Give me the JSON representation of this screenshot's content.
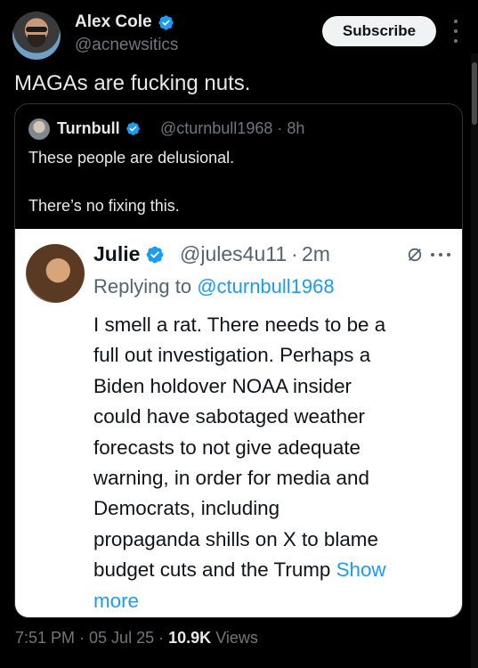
{
  "tweet": {
    "author": {
      "name": "Alex Cole",
      "handle": "@acnewsitics"
    },
    "subscribe_label": "Subscribe",
    "text": "MAGAs are fucking nuts.",
    "timestamp": "7:51 PM · 05 Jul 25",
    "separator": "·",
    "views_count": "10.9K",
    "views_label": "Views"
  },
  "quoted": {
    "author": {
      "name": "Turnbull",
      "handle": "@cturnbull1968 · 8h"
    },
    "line1": "These people are delusional.",
    "line2": "There’s no fixing this."
  },
  "embedded": {
    "author": {
      "name": "Julie",
      "handle": "@jules4u11",
      "dot": "·",
      "time": "2m"
    },
    "replying_prefix": "Replying to ",
    "replying_mention": "@cturnbull1968",
    "body_lines": [
      "I smell a rat. There needs to be a",
      "full out investigation. Perhaps a",
      "Biden holdover NOAA insider",
      "could have sabotaged weather",
      "forecasts to not give adequate",
      "warning, in order for media and",
      "Democrats, including",
      "propaganda shills on X to blame",
      "budget cuts and the Trump "
    ],
    "show_more_1": "Show",
    "show_more_2": "more"
  },
  "colors": {
    "background": "#000000",
    "text_primary": "#e7e9ea",
    "text_secondary": "#71767b",
    "accent_blue": "#1d9bf0",
    "card_border": "#2f3336"
  },
  "icons": {
    "verified": "verified-badge-icon",
    "more": "more-options-icon",
    "grok": "grok-icon"
  }
}
